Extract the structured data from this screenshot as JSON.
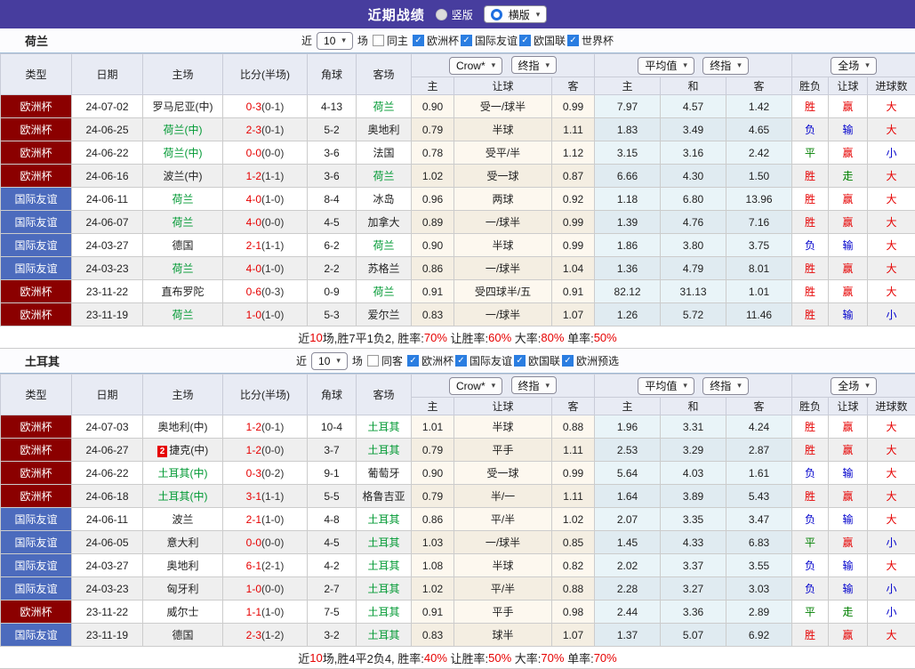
{
  "topbar": {
    "title": "近期战绩",
    "options": [
      {
        "label": "竖版",
        "selected": false
      },
      {
        "label": "横版",
        "selected": true
      }
    ]
  },
  "filter_labels": {
    "near": "近",
    "matches": "场"
  },
  "table_header": {
    "type": "类型",
    "date": "日期",
    "home": "主场",
    "score": "比分(半场)",
    "corner": "角球",
    "away": "客场",
    "odds_group": {
      "select1": "Crow*",
      "select2": "终指",
      "home": "主",
      "handicap": "让球",
      "away": "客"
    },
    "avg_group": {
      "select1": "平均值",
      "select2": "终指",
      "home": "主",
      "draw": "和",
      "away": "客"
    },
    "result_group": {
      "select1": "全场",
      "wdl": "胜负",
      "handicap": "让球",
      "goals": "进球数"
    }
  },
  "colors": {
    "topbar": "#473D9E",
    "europe_cup": "#8B0000",
    "friendly": "#4C6BBD",
    "team_green": "#009933",
    "score_red": "#E60000",
    "result_red": "#E60000",
    "result_green": "#008000",
    "result_blue": "#0000CC"
  },
  "sections": [
    {
      "team": "荷兰",
      "filter": {
        "count": "10",
        "same": "同主",
        "same_checked": false,
        "comps": [
          "欧洲杯",
          "国际友谊",
          "欧国联",
          "世界杯"
        ]
      },
      "rows": [
        {
          "type": "欧洲杯",
          "tc": "eur",
          "date": "24-07-02",
          "home": "罗马尼亚(中)",
          "hg": false,
          "score": "0-3",
          "half": "(0-1)",
          "corner": "4-13",
          "away": "荷兰",
          "ag": true,
          "o1": "0.90",
          "hd": "受一/球半",
          "o2": "0.99",
          "a1": "7.97",
          "a2": "4.57",
          "a3": "1.42",
          "r1": "胜",
          "r1c": "red",
          "r2": "赢",
          "r2c": "red",
          "r3": "大",
          "r3c": "red"
        },
        {
          "type": "欧洲杯",
          "tc": "eur",
          "date": "24-06-25",
          "home": "荷兰(中)",
          "hg": true,
          "score": "2-3",
          "half": "(0-1)",
          "corner": "5-2",
          "away": "奥地利",
          "ag": false,
          "o1": "0.79",
          "hd": "半球",
          "o2": "1.11",
          "a1": "1.83",
          "a2": "3.49",
          "a3": "4.65",
          "r1": "负",
          "r1c": "blue",
          "r2": "输",
          "r2c": "blue",
          "r3": "大",
          "r3c": "red"
        },
        {
          "type": "欧洲杯",
          "tc": "eur",
          "date": "24-06-22",
          "home": "荷兰(中)",
          "hg": true,
          "score": "0-0",
          "half": "(0-0)",
          "corner": "3-6",
          "away": "法国",
          "ag": false,
          "o1": "0.78",
          "hd": "受平/半",
          "o2": "1.12",
          "a1": "3.15",
          "a2": "3.16",
          "a3": "2.42",
          "r1": "平",
          "r1c": "grn",
          "r2": "赢",
          "r2c": "red",
          "r3": "小",
          "r3c": "blue"
        },
        {
          "type": "欧洲杯",
          "tc": "eur",
          "date": "24-06-16",
          "home": "波兰(中)",
          "hg": false,
          "score": "1-2",
          "half": "(1-1)",
          "corner": "3-6",
          "away": "荷兰",
          "ag": true,
          "o1": "1.02",
          "hd": "受一球",
          "o2": "0.87",
          "a1": "6.66",
          "a2": "4.30",
          "a3": "1.50",
          "r1": "胜",
          "r1c": "red",
          "r2": "走",
          "r2c": "grn",
          "r3": "大",
          "r3c": "red"
        },
        {
          "type": "国际友谊",
          "tc": "fri",
          "date": "24-06-11",
          "home": "荷兰",
          "hg": true,
          "score": "4-0",
          "half": "(1-0)",
          "corner": "8-4",
          "away": "冰岛",
          "ag": false,
          "o1": "0.96",
          "hd": "两球",
          "o2": "0.92",
          "a1": "1.18",
          "a2": "6.80",
          "a3": "13.96",
          "r1": "胜",
          "r1c": "red",
          "r2": "赢",
          "r2c": "red",
          "r3": "大",
          "r3c": "red"
        },
        {
          "type": "国际友谊",
          "tc": "fri",
          "date": "24-06-07",
          "home": "荷兰",
          "hg": true,
          "score": "4-0",
          "half": "(0-0)",
          "corner": "4-5",
          "away": "加拿大",
          "ag": false,
          "o1": "0.89",
          "hd": "一/球半",
          "o2": "0.99",
          "a1": "1.39",
          "a2": "4.76",
          "a3": "7.16",
          "r1": "胜",
          "r1c": "red",
          "r2": "赢",
          "r2c": "red",
          "r3": "大",
          "r3c": "red"
        },
        {
          "type": "国际友谊",
          "tc": "fri",
          "date": "24-03-27",
          "home": "德国",
          "hg": false,
          "score": "2-1",
          "half": "(1-1)",
          "corner": "6-2",
          "away": "荷兰",
          "ag": true,
          "o1": "0.90",
          "hd": "半球",
          "o2": "0.99",
          "a1": "1.86",
          "a2": "3.80",
          "a3": "3.75",
          "r1": "负",
          "r1c": "blue",
          "r2": "输",
          "r2c": "blue",
          "r3": "大",
          "r3c": "red"
        },
        {
          "type": "国际友谊",
          "tc": "fri",
          "date": "24-03-23",
          "home": "荷兰",
          "hg": true,
          "score": "4-0",
          "half": "(1-0)",
          "corner": "2-2",
          "away": "苏格兰",
          "ag": false,
          "o1": "0.86",
          "hd": "一/球半",
          "o2": "1.04",
          "a1": "1.36",
          "a2": "4.79",
          "a3": "8.01",
          "r1": "胜",
          "r1c": "red",
          "r2": "赢",
          "r2c": "red",
          "r3": "大",
          "r3c": "red"
        },
        {
          "type": "欧洲杯",
          "tc": "eur",
          "date": "23-11-22",
          "home": "直布罗陀",
          "hg": false,
          "score": "0-6",
          "half": "(0-3)",
          "corner": "0-9",
          "away": "荷兰",
          "ag": true,
          "o1": "0.91",
          "hd": "受四球半/五",
          "o2": "0.91",
          "a1": "82.12",
          "a2": "31.13",
          "a3": "1.01",
          "r1": "胜",
          "r1c": "red",
          "r2": "赢",
          "r2c": "red",
          "r3": "大",
          "r3c": "red"
        },
        {
          "type": "欧洲杯",
          "tc": "eur",
          "date": "23-11-19",
          "home": "荷兰",
          "hg": true,
          "score": "1-0",
          "half": "(1-0)",
          "corner": "5-3",
          "away": "爱尔兰",
          "ag": false,
          "o1": "0.83",
          "hd": "一/球半",
          "o2": "1.07",
          "a1": "1.26",
          "a2": "5.72",
          "a3": "11.46",
          "r1": "胜",
          "r1c": "red",
          "r2": "输",
          "r2c": "blue",
          "r3": "小",
          "r3c": "blue"
        }
      ],
      "summary": [
        {
          "t": "近"
        },
        {
          "t": "10",
          "r": true
        },
        {
          "t": "场,胜7平1负2, 胜率:"
        },
        {
          "t": "70%",
          "r": true
        },
        {
          "t": " 让胜率:"
        },
        {
          "t": "60%",
          "r": true
        },
        {
          "t": " 大率:"
        },
        {
          "t": "80%",
          "r": true
        },
        {
          "t": " 单率:"
        },
        {
          "t": "50%",
          "r": true
        }
      ]
    },
    {
      "team": "土耳其",
      "filter": {
        "count": "10",
        "same": "同客",
        "same_checked": false,
        "comps": [
          "欧洲杯",
          "国际友谊",
          "欧国联",
          "欧洲预选"
        ]
      },
      "rows": [
        {
          "type": "欧洲杯",
          "tc": "eur",
          "date": "24-07-03",
          "home": "奥地利(中)",
          "hg": false,
          "score": "1-2",
          "half": "(0-1)",
          "corner": "10-4",
          "away": "土耳其",
          "ag": true,
          "o1": "1.01",
          "hd": "半球",
          "o2": "0.88",
          "a1": "1.96",
          "a2": "3.31",
          "a3": "4.24",
          "r1": "胜",
          "r1c": "red",
          "r2": "赢",
          "r2c": "red",
          "r3": "大",
          "r3c": "red"
        },
        {
          "type": "欧洲杯",
          "tc": "eur",
          "date": "24-06-27",
          "home": "捷克(中)",
          "hg": false,
          "rc_text": "2",
          "score": "1-2",
          "half": "(0-0)",
          "corner": "3-7",
          "away": "土耳其",
          "ag": true,
          "o1": "0.79",
          "hd": "平手",
          "o2": "1.11",
          "a1": "2.53",
          "a2": "3.29",
          "a3": "2.87",
          "r1": "胜",
          "r1c": "red",
          "r2": "赢",
          "r2c": "red",
          "r3": "大",
          "r3c": "red"
        },
        {
          "type": "欧洲杯",
          "tc": "eur",
          "date": "24-06-22",
          "home": "土耳其(中)",
          "hg": true,
          "score": "0-3",
          "half": "(0-2)",
          "corner": "9-1",
          "away": "葡萄牙",
          "ag": false,
          "o1": "0.90",
          "hd": "受一球",
          "o2": "0.99",
          "a1": "5.64",
          "a2": "4.03",
          "a3": "1.61",
          "r1": "负",
          "r1c": "blue",
          "r2": "输",
          "r2c": "blue",
          "r3": "大",
          "r3c": "red"
        },
        {
          "type": "欧洲杯",
          "tc": "eur",
          "date": "24-06-18",
          "home": "土耳其(中)",
          "hg": true,
          "score": "3-1",
          "half": "(1-1)",
          "corner": "5-5",
          "away": "格鲁吉亚",
          "ag": false,
          "o1": "0.79",
          "hd": "半/一",
          "o2": "1.11",
          "a1": "1.64",
          "a2": "3.89",
          "a3": "5.43",
          "r1": "胜",
          "r1c": "red",
          "r2": "赢",
          "r2c": "red",
          "r3": "大",
          "r3c": "red"
        },
        {
          "type": "国际友谊",
          "tc": "fri",
          "date": "24-06-11",
          "home": "波兰",
          "hg": false,
          "score": "2-1",
          "half": "(1-0)",
          "corner": "4-8",
          "away": "土耳其",
          "ag": true,
          "o1": "0.86",
          "hd": "平/半",
          "o2": "1.02",
          "a1": "2.07",
          "a2": "3.35",
          "a3": "3.47",
          "r1": "负",
          "r1c": "blue",
          "r2": "输",
          "r2c": "blue",
          "r3": "大",
          "r3c": "red"
        },
        {
          "type": "国际友谊",
          "tc": "fri",
          "date": "24-06-05",
          "home": "意大利",
          "hg": false,
          "score": "0-0",
          "half": "(0-0)",
          "corner": "4-5",
          "away": "土耳其",
          "ag": true,
          "o1": "1.03",
          "hd": "一/球半",
          "o2": "0.85",
          "a1": "1.45",
          "a2": "4.33",
          "a3": "6.83",
          "r1": "平",
          "r1c": "grn",
          "r2": "赢",
          "r2c": "red",
          "r3": "小",
          "r3c": "blue"
        },
        {
          "type": "国际友谊",
          "tc": "fri",
          "date": "24-03-27",
          "home": "奥地利",
          "hg": false,
          "score": "6-1",
          "half": "(2-1)",
          "corner": "4-2",
          "away": "土耳其",
          "ag": true,
          "o1": "1.08",
          "hd": "半球",
          "o2": "0.82",
          "a1": "2.02",
          "a2": "3.37",
          "a3": "3.55",
          "r1": "负",
          "r1c": "blue",
          "r2": "输",
          "r2c": "blue",
          "r3": "大",
          "r3c": "red"
        },
        {
          "type": "国际友谊",
          "tc": "fri",
          "date": "24-03-23",
          "home": "匈牙利",
          "hg": false,
          "score": "1-0",
          "half": "(0-0)",
          "corner": "2-7",
          "away": "土耳其",
          "ag": true,
          "o1": "1.02",
          "hd": "平/半",
          "o2": "0.88",
          "a1": "2.28",
          "a2": "3.27",
          "a3": "3.03",
          "r1": "负",
          "r1c": "blue",
          "r2": "输",
          "r2c": "blue",
          "r3": "小",
          "r3c": "blue"
        },
        {
          "type": "欧洲杯",
          "tc": "eur",
          "date": "23-11-22",
          "home": "威尔士",
          "hg": false,
          "score": "1-1",
          "half": "(1-0)",
          "corner": "7-5",
          "away": "土耳其",
          "ag": true,
          "o1": "0.91",
          "hd": "平手",
          "o2": "0.98",
          "a1": "2.44",
          "a2": "3.36",
          "a3": "2.89",
          "r1": "平",
          "r1c": "grn",
          "r2": "走",
          "r2c": "grn",
          "r3": "小",
          "r3c": "blue"
        },
        {
          "type": "国际友谊",
          "tc": "fri",
          "date": "23-11-19",
          "home": "德国",
          "hg": false,
          "score": "2-3",
          "half": "(1-2)",
          "corner": "3-2",
          "away": "土耳其",
          "ag": true,
          "o1": "0.83",
          "hd": "球半",
          "o2": "1.07",
          "a1": "1.37",
          "a2": "5.07",
          "a3": "6.92",
          "r1": "胜",
          "r1c": "red",
          "r2": "赢",
          "r2c": "red",
          "r3": "大",
          "r3c": "red"
        }
      ],
      "summary": [
        {
          "t": "近"
        },
        {
          "t": "10",
          "r": true
        },
        {
          "t": "场,胜4平2负4, 胜率:"
        },
        {
          "t": "40%",
          "r": true
        },
        {
          "t": " 让胜率:"
        },
        {
          "t": "50%",
          "r": true
        },
        {
          "t": " 大率:"
        },
        {
          "t": "70%",
          "r": true
        },
        {
          "t": " 单率:"
        },
        {
          "t": "70%",
          "r": true
        }
      ]
    }
  ]
}
